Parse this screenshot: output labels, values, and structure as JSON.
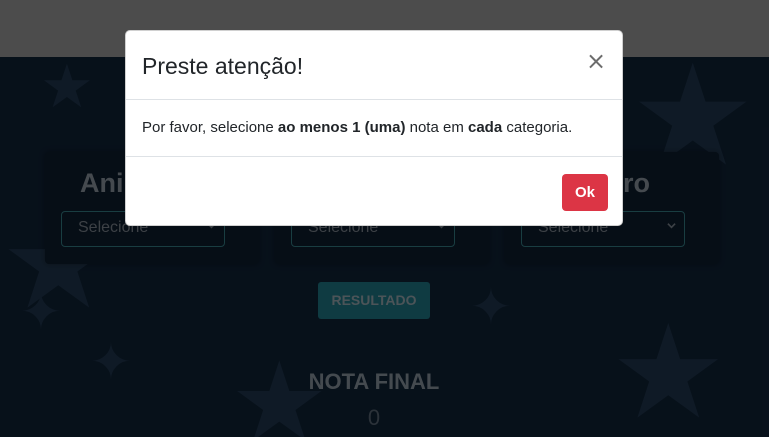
{
  "background": {
    "cards": [
      {
        "title": "Ani",
        "select_value": "Selecione"
      },
      {
        "title": "",
        "select_value": "Selecione"
      },
      {
        "title": "ro",
        "select_value": "Selecione"
      }
    ],
    "result_button": "RESULTADO",
    "final_title": "NOTA FINAL",
    "final_value": "0"
  },
  "modal": {
    "title": "Preste atenção!",
    "close_label": "×",
    "message_parts": [
      "Por favor, selecione ",
      "ao menos 1 (uma)",
      " nota em ",
      "cada",
      " categoria."
    ],
    "ok_label": "Ok"
  },
  "colors": {
    "ok_button": "#dc3545",
    "page_background": "#0e1f31",
    "result_button": "#1d6c78"
  }
}
